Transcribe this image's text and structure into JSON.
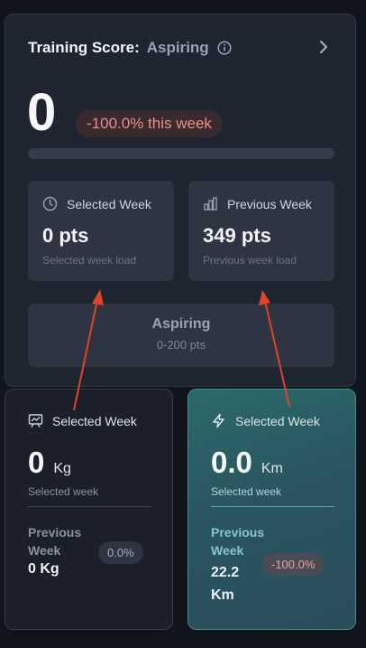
{
  "score_card": {
    "title": "Training Score:",
    "level": "Aspiring",
    "score": "0",
    "change_badge": "-100.0% this week",
    "progress_fraction": 0,
    "selected_week": {
      "label": "Selected Week",
      "value": "0 pts",
      "sub": "Selected week load",
      "icon": "clock-icon"
    },
    "previous_week": {
      "label": "Previous Week",
      "value": "349 pts",
      "sub": "Previous week load",
      "icon": "bar-chart-icon"
    },
    "level_box": {
      "name": "Aspiring",
      "range": "0-200 pts"
    }
  },
  "weight_card": {
    "label": "Selected Week",
    "value": "0",
    "unit": "Kg",
    "sub": "Selected week",
    "prev_label": "Previous Week",
    "prev_value": "0 Kg",
    "badge": "0.0%",
    "icon": "presentation-chart-icon"
  },
  "distance_card": {
    "label": "Selected Week",
    "value": "0.0",
    "unit": "Km",
    "sub": "Selected week",
    "prev_label": "Previous Week",
    "prev_value": "22.2 Km",
    "badge": "-100.0%",
    "icon": "lightning-icon"
  },
  "colors": {
    "accent_teal": "#2a6a6a",
    "negative_text": "#e98e8b",
    "annotation_arrow": "#e0432b"
  }
}
